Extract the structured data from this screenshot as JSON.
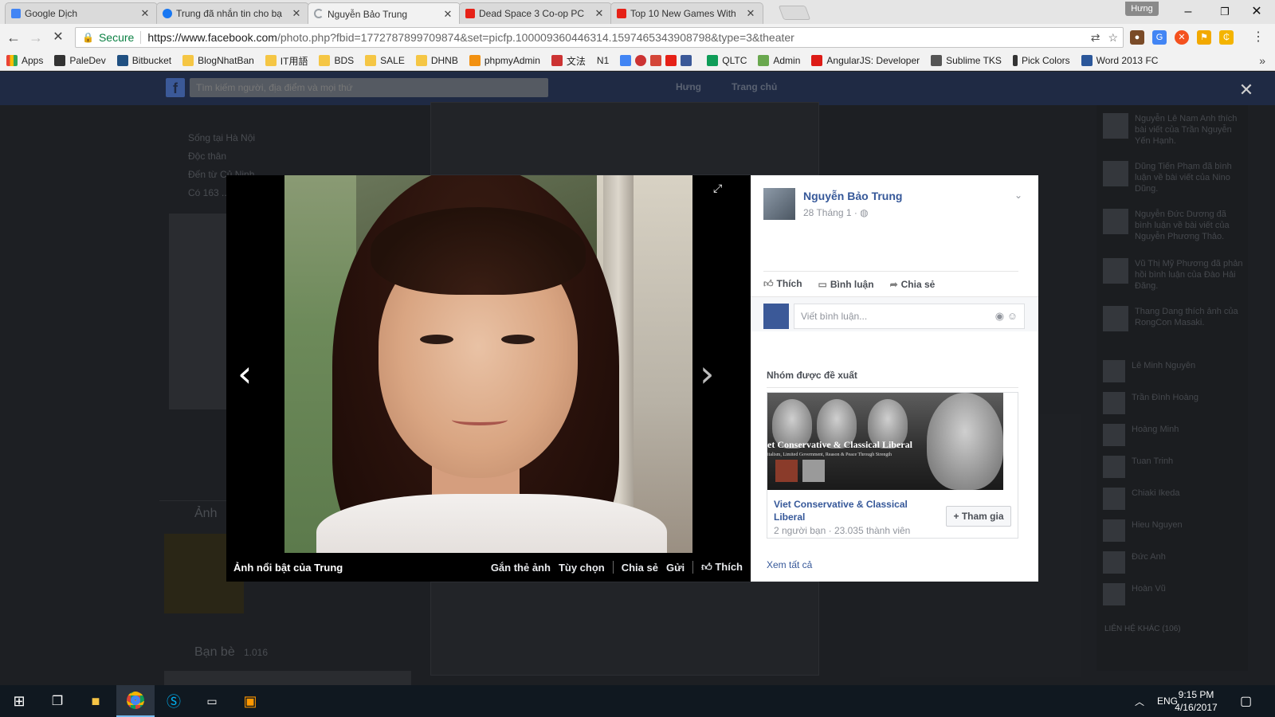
{
  "browser": {
    "tabs": [
      {
        "label": "Google Dịch",
        "color": "#4285f4"
      },
      {
        "label": "Trung đã nhắn tin cho bạ",
        "color": "#1877f2"
      },
      {
        "label": "Nguyễn Bảo Trung",
        "color": "#9aa0a6"
      },
      {
        "label": "Dead Space 3 Co-op PC",
        "color": "#e62117"
      },
      {
        "label": "Top 10 New Games With",
        "color": "#e62117"
      }
    ],
    "profile": "Hưng",
    "secure_label": "Secure",
    "url_main": "https://www.facebook.com",
    "url_rest": "/photo.php?fbid=1772787899709874&set=picfp.100009360446314.1597465343908798&type=3&theater",
    "bookmarks": [
      "Apps",
      "PaleDev",
      "Bitbucket",
      "BlogNhatBan",
      "IT用語",
      "BDS",
      "SALE",
      "DHNB",
      "phpmyAdmin",
      "文法",
      "N1",
      "QLTC",
      "Admin",
      "AngularJS: Developer",
      "Sublime TKS",
      "Pick Colors",
      "Word 2013 FC"
    ]
  },
  "facebook": {
    "search_placeholder": "Tìm kiếm người, địa điểm và mọi thứ",
    "nav_user": "Hưng",
    "nav_home": "Trang chủ",
    "bg_left": {
      "line1": "Sống tại Hà Nội",
      "line2": "Độc thân",
      "line3": "Đến từ Củ Ninh",
      "line4": "Có 163 ...",
      "photos": "Ảnh",
      "friends": "Bạn bè",
      "friends_count": "1.016"
    },
    "rail": [
      {
        "text": "Nguyễn Lê Nam Anh thích bài viết của Trần Nguyễn Yến Hạnh."
      },
      {
        "text": "Dũng Tiến Phạm đã bình luận về bài viết của Nino Dũng."
      },
      {
        "text": "Nguyễn Đức Dương đã bình luận về bài viết của Nguyễn Phương Thảo."
      },
      {
        "text": "Vũ Thị Mỹ Phương đã phản hồi bình luận của Đào Hải Đăng."
      },
      {
        "text": "Thang Dang thích ảnh của RongCon Masaki."
      },
      {
        "text": "Lê Minh Nguyên"
      },
      {
        "text": "Trần Đình Hoàng"
      },
      {
        "text": "Hoàng Minh"
      },
      {
        "text": "Tuan Trinh"
      },
      {
        "text": "Chiaki Ikeda"
      },
      {
        "text": "Hieu Nguyen"
      },
      {
        "text": "Đức Anh"
      },
      {
        "text": "Hoàn Vũ"
      }
    ],
    "rail_section": "LIÊN HỆ KHÁC (106)"
  },
  "theater": {
    "caption": "Ảnh nổi bật của Trung",
    "actions": [
      "Gắn thẻ ảnh",
      "Tùy chọn",
      "Chia sẻ",
      "Gửi"
    ],
    "like": "Thích",
    "author": "Nguyễn Bảo Trung",
    "date": "28 Tháng 1 · ",
    "side_actions": {
      "like": "Thích",
      "comment": "Bình luận",
      "share": "Chia sẻ"
    },
    "comment_placeholder": "Viết bình luận...",
    "suggested_title": "Nhóm được đề xuất",
    "group": {
      "banner": "et Conservative & Classical Liberal",
      "banner_sub": "italism, Limited Government, Reason & Peace Through Strength",
      "name": "Viet Conservative & Classical Liberal",
      "meta": "2 người bạn · 23.035 thành viên",
      "join": "+ Tham gia"
    },
    "see_all": "Xem tất cả"
  },
  "taskbar": {
    "lang": "ENG",
    "time": "9:15 PM",
    "date": "4/16/2017"
  },
  "colors": {
    "fb_blue": "#365899",
    "chrome_bg": "#f2f2f2",
    "taskbar": "#101820"
  }
}
